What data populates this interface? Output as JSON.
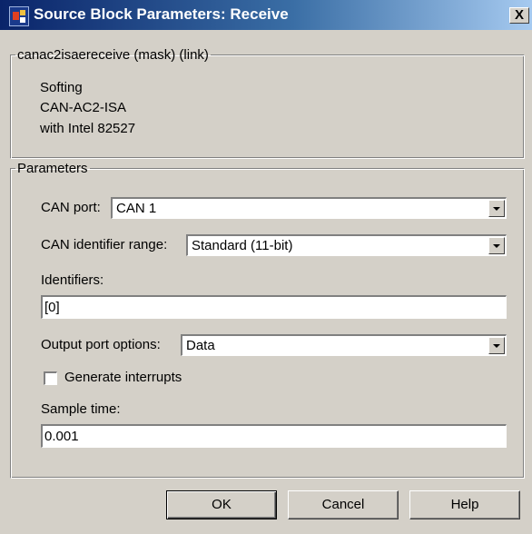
{
  "window": {
    "title": "Source Block Parameters: Receive",
    "app_icon": "simulink-block-icon",
    "close_label": "X"
  },
  "description": {
    "legend": "canac2isaereceive (mask) (link)",
    "lines": [
      "Softing",
      "CAN-AC2-ISA",
      "with Intel 82527"
    ]
  },
  "parameters": {
    "legend": "Parameters",
    "can_port": {
      "label": "CAN port:",
      "value": "CAN 1"
    },
    "id_range": {
      "label": "CAN identifier range:",
      "value": "Standard (11-bit)"
    },
    "identifiers": {
      "label": "Identifiers:",
      "value": "[0]"
    },
    "output_port": {
      "label": "Output port options:",
      "value": "Data"
    },
    "generate_interrupts": {
      "label": "Generate interrupts",
      "checked": false
    },
    "sample_time": {
      "label": "Sample time:",
      "value": "0.001"
    }
  },
  "buttons": {
    "ok": "OK",
    "cancel": "Cancel",
    "help": "Help"
  },
  "colors": {
    "title_start": "#0a246a",
    "title_end": "#a6caf0",
    "face": "#d4d0c8"
  }
}
